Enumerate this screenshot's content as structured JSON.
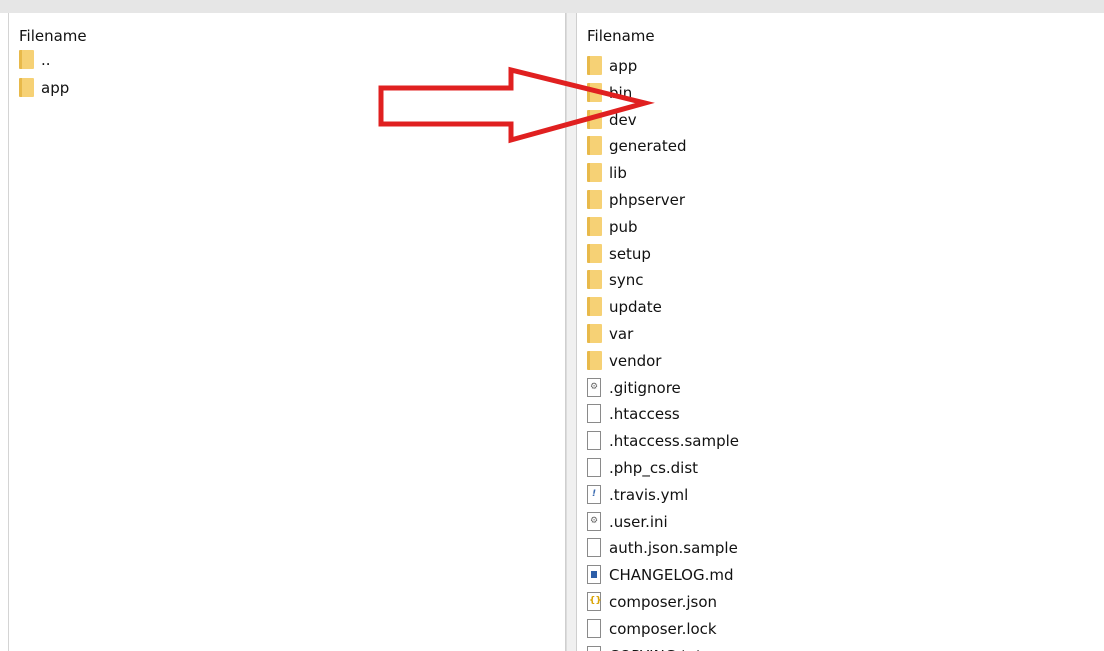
{
  "left_pane": {
    "header": "Filename",
    "items": [
      {
        "name": "..",
        "type": "folder",
        "icon": "folder-icon"
      },
      {
        "name": "app",
        "type": "folder",
        "icon": "folder-icon"
      }
    ]
  },
  "right_pane": {
    "header": "Filename",
    "items": [
      {
        "name": "app",
        "type": "folder",
        "icon": "folder-icon"
      },
      {
        "name": "bin",
        "type": "folder",
        "icon": "folder-icon"
      },
      {
        "name": "dev",
        "type": "folder",
        "icon": "folder-icon"
      },
      {
        "name": "generated",
        "type": "folder",
        "icon": "folder-icon"
      },
      {
        "name": "lib",
        "type": "folder",
        "icon": "folder-icon"
      },
      {
        "name": "phpserver",
        "type": "folder",
        "icon": "folder-icon"
      },
      {
        "name": "pub",
        "type": "folder",
        "icon": "folder-icon"
      },
      {
        "name": "setup",
        "type": "folder",
        "icon": "folder-icon"
      },
      {
        "name": "sync",
        "type": "folder",
        "icon": "folder-icon"
      },
      {
        "name": "update",
        "type": "folder",
        "icon": "folder-icon"
      },
      {
        "name": "var",
        "type": "folder",
        "icon": "folder-icon"
      },
      {
        "name": "vendor",
        "type": "folder",
        "icon": "folder-icon"
      },
      {
        "name": ".gitignore",
        "type": "cfg",
        "icon": "gear-file-icon"
      },
      {
        "name": ".htaccess",
        "type": "file",
        "icon": "file-icon"
      },
      {
        "name": ".htaccess.sample",
        "type": "file",
        "icon": "file-icon"
      },
      {
        "name": ".php_cs.dist",
        "type": "file",
        "icon": "file-icon"
      },
      {
        "name": ".travis.yml",
        "type": "yml",
        "icon": "yml-file-icon"
      },
      {
        "name": ".user.ini",
        "type": "cfg",
        "icon": "gear-file-icon"
      },
      {
        "name": "auth.json.sample",
        "type": "file",
        "icon": "file-icon"
      },
      {
        "name": "CHANGELOG.md",
        "type": "md",
        "icon": "markdown-file-icon"
      },
      {
        "name": "composer.json",
        "type": "json",
        "icon": "json-file-icon"
      },
      {
        "name": "composer.lock",
        "type": "file",
        "icon": "file-icon"
      },
      {
        "name": "COPYING.txt",
        "type": "file",
        "icon": "file-icon"
      }
    ]
  },
  "overlay": {
    "icon": "red-arrow-icon",
    "color": "#e02020"
  },
  "colors": {
    "folder": "#f6d175",
    "folder_edge": "#e8b94a",
    "arrow": "#e02020"
  }
}
